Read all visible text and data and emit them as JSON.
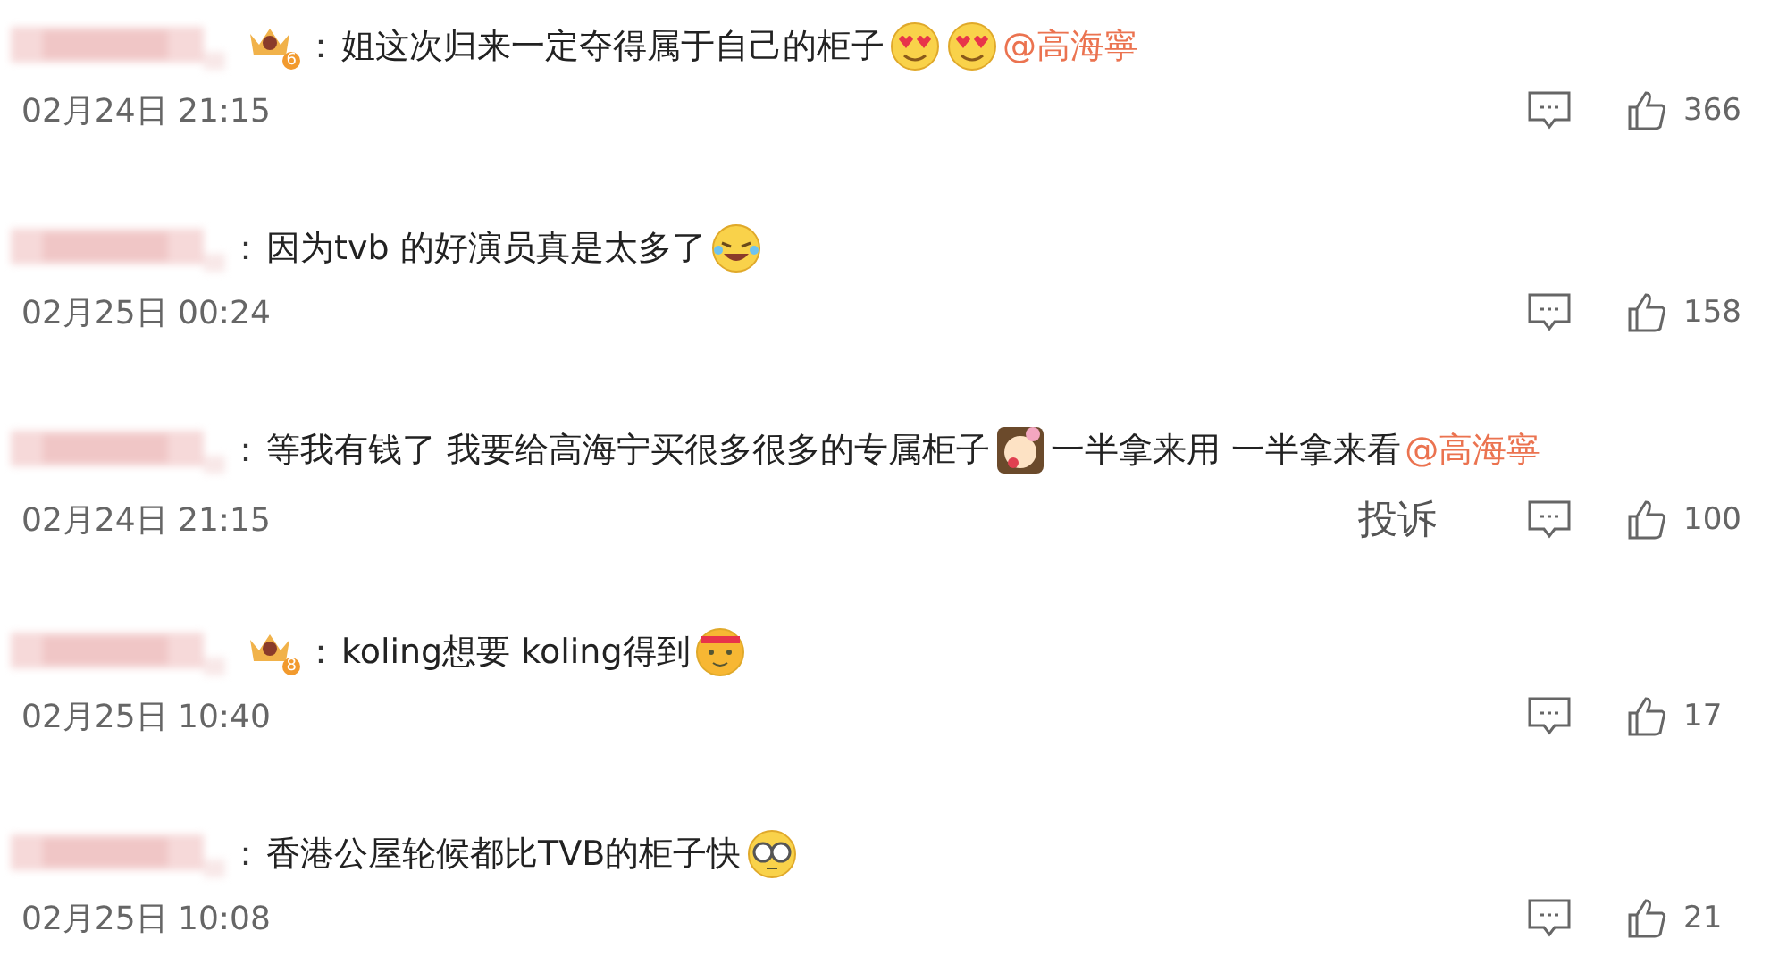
{
  "comments": [
    {
      "badge": "6",
      "separator": "：",
      "segments": [
        {
          "kind": "text",
          "text": "姐这次归来一定夺得属于自己的柜子"
        },
        {
          "kind": "hearts"
        },
        {
          "kind": "hearts"
        },
        {
          "kind": "mention",
          "text": "@高海寧"
        }
      ],
      "time": "02月24日 21:15",
      "likes": "366"
    },
    {
      "separator": "：",
      "segments": [
        {
          "kind": "text",
          "text": "因为tvb 的好演员真是太多了"
        },
        {
          "kind": "laugh"
        }
      ],
      "time": "02月25日 00:24",
      "likes": "158"
    },
    {
      "separator": "：",
      "segments": [
        {
          "kind": "text",
          "text": "等我有钱了 我要给高海宁买很多很多的专属柜子"
        },
        {
          "kind": "girl"
        },
        {
          "kind": "text",
          "text": "一半拿来用 一半拿来看"
        },
        {
          "kind": "mention",
          "text": "@高海寧"
        }
      ],
      "time": "02月24日 21:15",
      "report": "投诉",
      "likes": "100"
    },
    {
      "badge": "8",
      "separator": "：",
      "segments": [
        {
          "kind": "text",
          "text": "koling想要 koling得到"
        },
        {
          "kind": "hot"
        }
      ],
      "time": "02月25日 10:40",
      "likes": "17"
    },
    {
      "separator": "：",
      "segments": [
        {
          "kind": "text",
          "text": "香港公屋轮候都比TVB的柜子快"
        },
        {
          "kind": "glasses"
        }
      ],
      "time": "02月25日 10:08",
      "likes": "21"
    }
  ]
}
